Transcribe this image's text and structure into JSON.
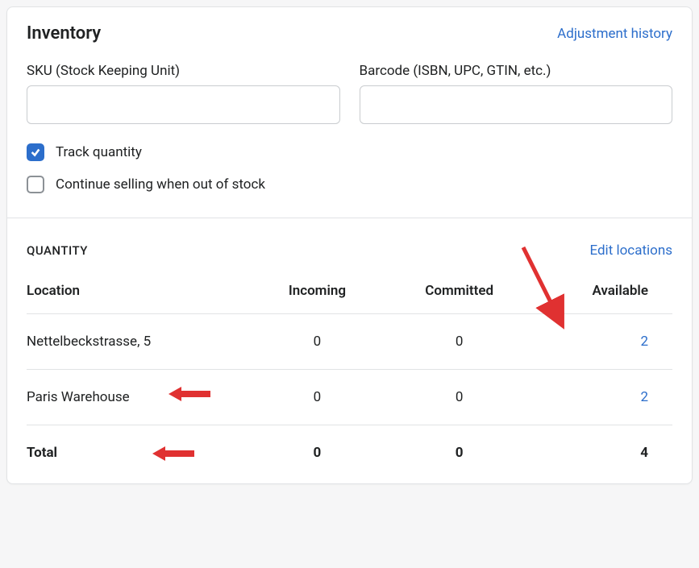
{
  "header": {
    "title": "Inventory",
    "history_link": "Adjustment history"
  },
  "fields": {
    "sku_label": "SKU (Stock Keeping Unit)",
    "sku_value": "",
    "barcode_label": "Barcode (ISBN, UPC, GTIN, etc.)",
    "barcode_value": ""
  },
  "options": {
    "track_label": "Track quantity",
    "track_checked": true,
    "continue_label": "Continue selling when out of stock",
    "continue_checked": false
  },
  "quantity": {
    "section_label": "QUANTITY",
    "edit_link": "Edit locations",
    "columns": {
      "location": "Location",
      "incoming": "Incoming",
      "committed": "Committed",
      "available": "Available"
    },
    "rows": [
      {
        "location": "Nettelbeckstrasse, 5",
        "incoming": "0",
        "committed": "0",
        "available": "2"
      },
      {
        "location": "Paris Warehouse",
        "incoming": "0",
        "committed": "0",
        "available": "2"
      }
    ],
    "total": {
      "label": "Total",
      "incoming": "0",
      "committed": "0",
      "available": "4"
    }
  }
}
